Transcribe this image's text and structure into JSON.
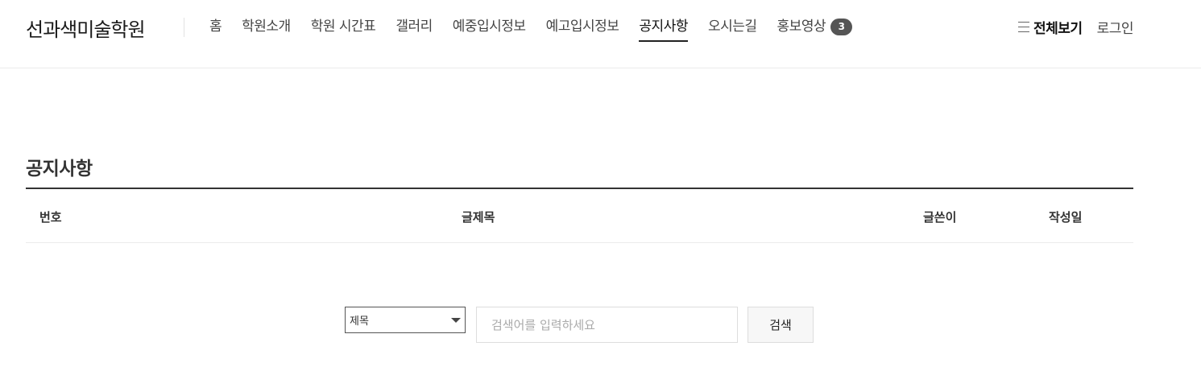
{
  "header": {
    "logo": "선과색미술학원",
    "nav": [
      {
        "label": "홈",
        "active": false
      },
      {
        "label": "학원소개",
        "active": false
      },
      {
        "label": "학원 시간표",
        "active": false
      },
      {
        "label": "갤러리",
        "active": false
      },
      {
        "label": "예중입시정보",
        "active": false
      },
      {
        "label": "예고입시정보",
        "active": false
      },
      {
        "label": "공지사항",
        "active": true
      },
      {
        "label": "오시는길",
        "active": false
      },
      {
        "label": "홍보영상",
        "active": false,
        "badge": "3"
      }
    ],
    "all_menu_label": "전체보기",
    "all_menu_icon": "hamburger-icon",
    "login_label": "로그인"
  },
  "main": {
    "page_title": "공지사항",
    "table": {
      "columns": [
        "번호",
        "글제목",
        "글쓴이",
        "작성일"
      ],
      "rows": []
    },
    "search": {
      "select_value": "제목",
      "placeholder": "검색어를 입력하세요",
      "button_label": "검색"
    }
  },
  "colors": {
    "badge_bg": "#555555",
    "table_top_border": "#333333",
    "active_underline": "#222222"
  }
}
